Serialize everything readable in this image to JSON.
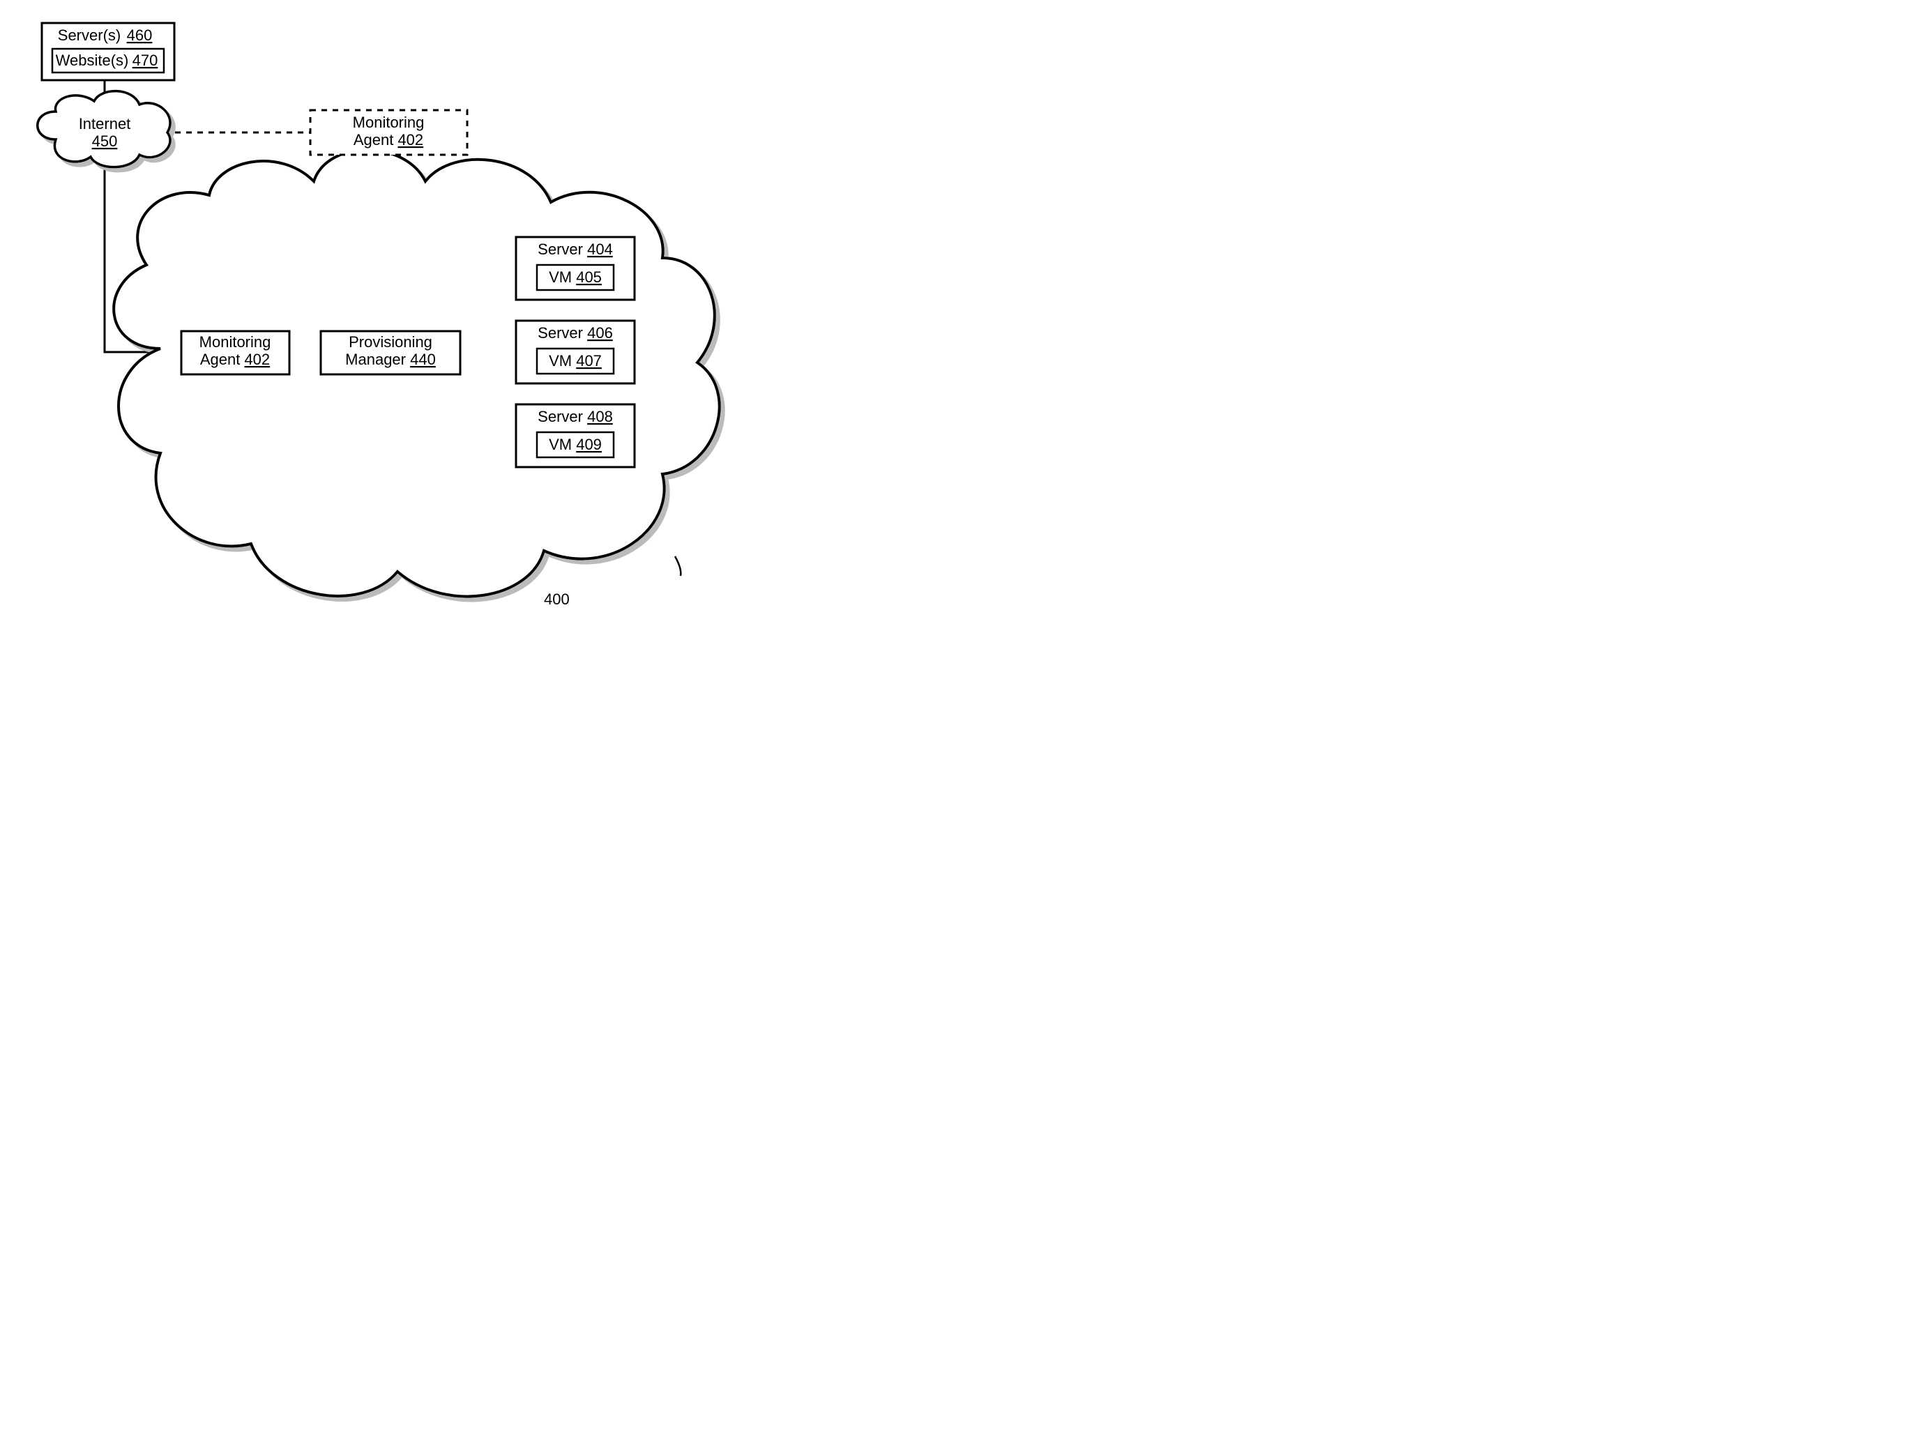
{
  "serversBox": {
    "label": "Server(s)",
    "ref": "460"
  },
  "websitesBox": {
    "label": "Website(s)",
    "ref": "470"
  },
  "internetCloud": {
    "label": "Internet",
    "ref": "450"
  },
  "monitorExt": {
    "label": "Monitoring Agent",
    "ref": "402"
  },
  "monitorInt": {
    "label": "Monitoring Agent",
    "ref": "402"
  },
  "provMgr": {
    "label": "Provisioning Manager",
    "ref": "440"
  },
  "srv1": {
    "label": "Server",
    "ref": "404",
    "vmLabel": "VM",
    "vmRef": "405"
  },
  "srv2": {
    "label": "Server",
    "ref": "406",
    "vmLabel": "VM",
    "vmRef": "407"
  },
  "srv3": {
    "label": "Server",
    "ref": "408",
    "vmLabel": "VM",
    "vmRef": "409"
  },
  "bigCloudRef": "400"
}
